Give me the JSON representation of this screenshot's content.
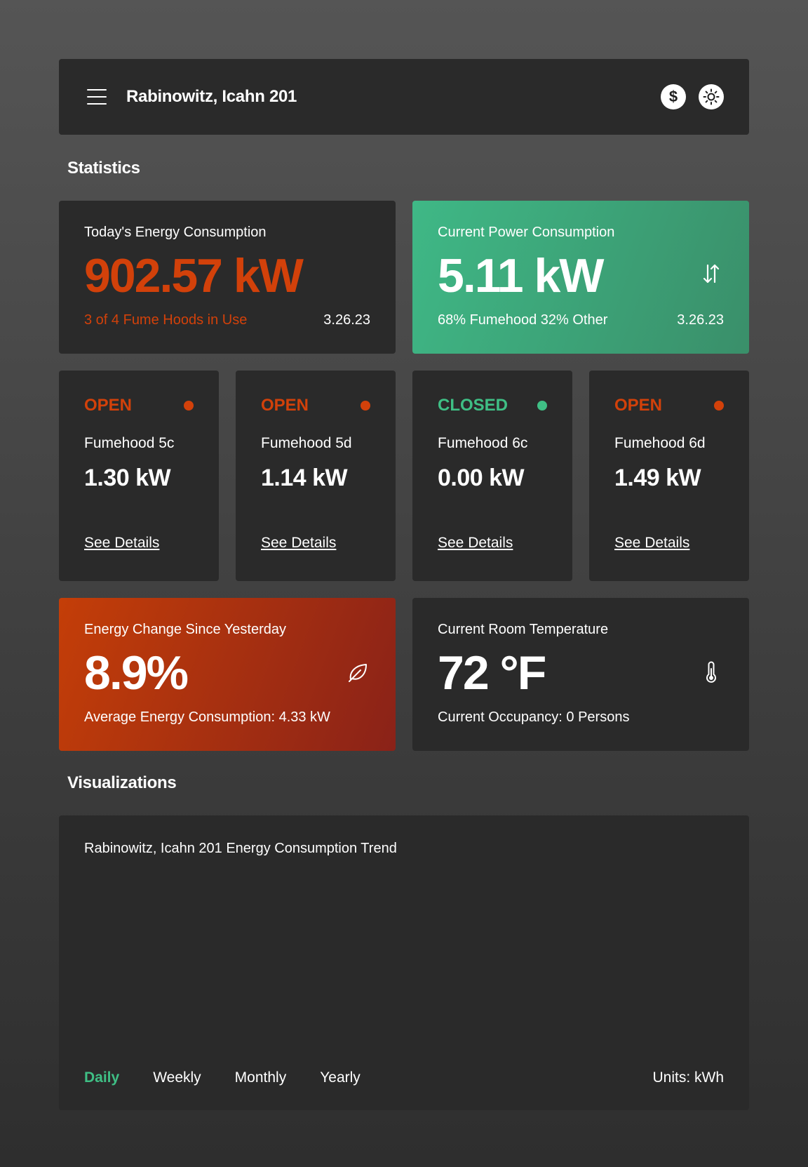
{
  "header": {
    "title": "Rabinowitz, Icahn 201",
    "cost_icon": "$"
  },
  "sections": {
    "statistics": "Statistics",
    "visualizations": "Visualizations"
  },
  "energy_today": {
    "label": "Today's Energy Consumption",
    "value": "902.57 kW",
    "note": "3 of 4 Fume Hoods in Use",
    "date": "3.26.23"
  },
  "power_current": {
    "label": "Current Power Consumption",
    "value": "5.11 kW",
    "breakdown": "68% Fumehood 32% Other",
    "date": "3.26.23"
  },
  "fumehoods": [
    {
      "status": "OPEN",
      "name": "Fumehood 5c",
      "value": "1.30 kW",
      "link": "See Details",
      "color": "#d2410a"
    },
    {
      "status": "OPEN",
      "name": "Fumehood 5d",
      "value": "1.14 kW",
      "link": "See Details",
      "color": "#d2410a"
    },
    {
      "status": "CLOSED",
      "name": "Fumehood 6c",
      "value": "0.00 kW",
      "link": "See Details",
      "color": "#3fbf85"
    },
    {
      "status": "OPEN",
      "name": "Fumehood 6d",
      "value": "1.49 kW",
      "link": "See Details",
      "color": "#d2410a"
    }
  ],
  "energy_change": {
    "label": "Energy Change Since Yesterday",
    "value": "8.9%",
    "note": "Average Energy Consumption: 4.33 kW"
  },
  "room_temp": {
    "label": "Current Room Temperature",
    "value": "72 °F",
    "note": "Current Occupancy: 0 Persons"
  },
  "visualization": {
    "title": "Rabinowitz, Icahn 201 Energy Consumption Trend",
    "tabs": [
      "Daily",
      "Weekly",
      "Monthly",
      "Yearly"
    ],
    "active_tab": "Daily",
    "units": "Units: kWh"
  },
  "colors": {
    "open": "#d2410a",
    "closed": "#3fbf85",
    "card": "#2a2a2a"
  },
  "icons": {
    "menu": "menu-icon",
    "cost": "dollar-icon",
    "theme": "sun-icon",
    "power": "up-down-arrows-icon",
    "energy_change": "leaf-icon",
    "temperature": "thermometer-icon"
  }
}
